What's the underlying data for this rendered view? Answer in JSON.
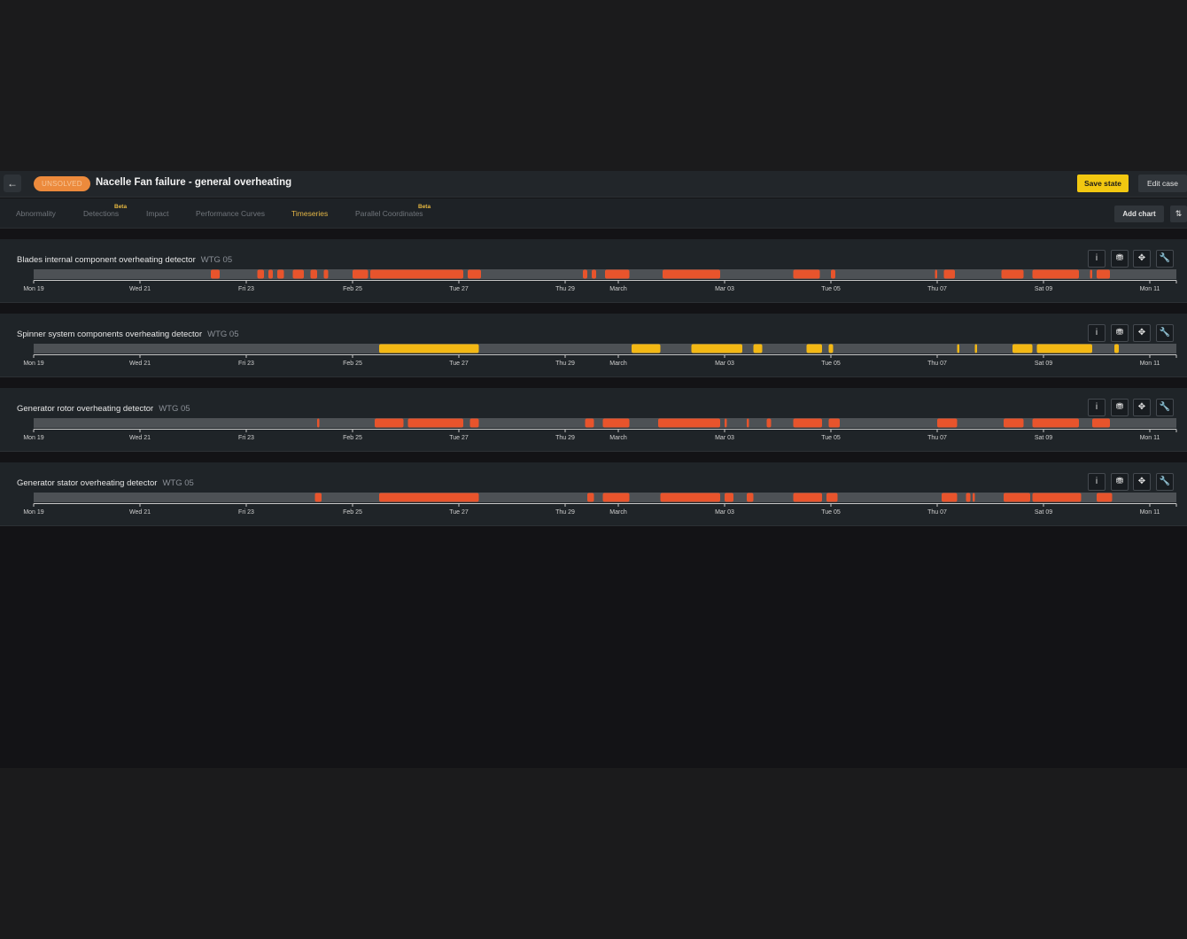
{
  "header": {
    "back_icon": "arrow-left-icon",
    "status": "UNSOLVED",
    "title": "Nacelle Fan failure - general overheating",
    "save_label": "Save state",
    "edit_label": "Edit case"
  },
  "tabs": [
    {
      "label": "Abnormality",
      "beta": ""
    },
    {
      "label": "Detections",
      "beta": "Beta"
    },
    {
      "label": "Impact",
      "beta": ""
    },
    {
      "label": "Performance Curves",
      "beta": ""
    },
    {
      "label": "Timeseries",
      "beta": ""
    },
    {
      "label": "Parallel Coordinates",
      "beta": "Beta"
    }
  ],
  "active_tab": "Timeseries",
  "toolbar": {
    "add_chart_label": "Add chart",
    "sort_icon": "sort-icon"
  },
  "controls": {
    "info": "i",
    "filter": "⛃",
    "move": "✥",
    "wrench": "🔧"
  },
  "colors": {
    "red_event": "#e8542c",
    "yellow_event": "#f3b814",
    "track": "#4d5155",
    "accent": "#f2c811"
  },
  "time_axis": {
    "start": "2024-02-19T00:00",
    "end": "2024-03-11T12:00",
    "ticks": [
      {
        "label": "Mon 19",
        "date": "2024-02-19"
      },
      {
        "label": "Wed 21",
        "date": "2024-02-21"
      },
      {
        "label": "Fri 23",
        "date": "2024-02-23"
      },
      {
        "label": "Feb 25",
        "date": "2024-02-25"
      },
      {
        "label": "Tue 27",
        "date": "2024-02-27"
      },
      {
        "label": "Thu 29",
        "date": "2024-02-29"
      },
      {
        "label": "March",
        "date": "2024-03-01"
      },
      {
        "label": "Mar 03",
        "date": "2024-03-03"
      },
      {
        "label": "Tue 05",
        "date": "2024-03-05"
      },
      {
        "label": "Thu 07",
        "date": "2024-03-07"
      },
      {
        "label": "Sat 09",
        "date": "2024-03-09"
      },
      {
        "label": "Mon 11",
        "date": "2024-03-11"
      }
    ]
  },
  "detectors": [
    {
      "name": "Blades internal component overheating detector",
      "asset": "WTG 05",
      "color": "#e8542c",
      "events": [
        [
          "2024-02-22T08:00",
          "2024-02-22T12:00"
        ],
        [
          "2024-02-23T05:00",
          "2024-02-23T08:00"
        ],
        [
          "2024-02-23T10:00",
          "2024-02-23T12:00"
        ],
        [
          "2024-02-23T14:00",
          "2024-02-23T17:00"
        ],
        [
          "2024-02-23T21:00",
          "2024-02-24T02:00"
        ],
        [
          "2024-02-24T05:00",
          "2024-02-24T08:00"
        ],
        [
          "2024-02-24T11:00",
          "2024-02-24T13:00"
        ],
        [
          "2024-02-25T00:00",
          "2024-02-25T07:00"
        ],
        [
          "2024-02-25T08:00",
          "2024-02-27T02:00"
        ],
        [
          "2024-02-27T04:00",
          "2024-02-27T10:00"
        ],
        [
          "2024-02-29T08:00",
          "2024-02-29T10:00"
        ],
        [
          "2024-02-29T12:00",
          "2024-02-29T14:00"
        ],
        [
          "2024-02-29T18:00",
          "2024-03-01T05:00"
        ],
        [
          "2024-03-01T20:00",
          "2024-03-02T22:00"
        ],
        [
          "2024-03-04T07:00",
          "2024-03-04T19:00"
        ],
        [
          "2024-03-05T00:00",
          "2024-03-05T02:00"
        ],
        [
          "2024-03-06T23:00",
          "2024-03-07T00:00"
        ],
        [
          "2024-03-07T03:00",
          "2024-03-07T08:00"
        ],
        [
          "2024-03-08T05:00",
          "2024-03-08T15:00"
        ],
        [
          "2024-03-08T19:00",
          "2024-03-09T16:00"
        ],
        [
          "2024-03-09T21:00",
          "2024-03-09T22:00"
        ],
        [
          "2024-03-10T00:00",
          "2024-03-10T06:00"
        ]
      ]
    },
    {
      "name": "Spinner system components overheating detector",
      "asset": "WTG 05",
      "color": "#f3b814",
      "events": [
        [
          "2024-02-25T12:00",
          "2024-02-27T09:00"
        ],
        [
          "2024-03-01T06:00",
          "2024-03-01T19:00"
        ],
        [
          "2024-03-02T09:00",
          "2024-03-03T08:00"
        ],
        [
          "2024-03-03T13:00",
          "2024-03-03T17:00"
        ],
        [
          "2024-03-04T13:00",
          "2024-03-04T20:00"
        ],
        [
          "2024-03-04T23:00",
          "2024-03-05T01:00"
        ],
        [
          "2024-03-07T09:00",
          "2024-03-07T10:00"
        ],
        [
          "2024-03-07T17:00",
          "2024-03-07T18:00"
        ],
        [
          "2024-03-08T10:00",
          "2024-03-08T19:00"
        ],
        [
          "2024-03-08T21:00",
          "2024-03-09T22:00"
        ],
        [
          "2024-03-10T08:00",
          "2024-03-10T10:00"
        ]
      ]
    },
    {
      "name": "Generator rotor overheating detector",
      "asset": "WTG 05",
      "color": "#e8542c",
      "events": [
        [
          "2024-02-24T08:00",
          "2024-02-24T09:00"
        ],
        [
          "2024-02-25T10:00",
          "2024-02-25T23:00"
        ],
        [
          "2024-02-26T01:00",
          "2024-02-27T02:00"
        ],
        [
          "2024-02-27T05:00",
          "2024-02-27T09:00"
        ],
        [
          "2024-02-29T09:00",
          "2024-02-29T13:00"
        ],
        [
          "2024-02-29T17:00",
          "2024-03-01T05:00"
        ],
        [
          "2024-03-01T18:00",
          "2024-03-02T22:00"
        ],
        [
          "2024-03-03T00:00",
          "2024-03-03T01:00"
        ],
        [
          "2024-03-03T10:00",
          "2024-03-03T11:00"
        ],
        [
          "2024-03-03T19:00",
          "2024-03-03T21:00"
        ],
        [
          "2024-03-04T07:00",
          "2024-03-04T20:00"
        ],
        [
          "2024-03-04T23:00",
          "2024-03-05T04:00"
        ],
        [
          "2024-03-07T00:00",
          "2024-03-07T09:00"
        ],
        [
          "2024-03-08T06:00",
          "2024-03-08T15:00"
        ],
        [
          "2024-03-08T19:00",
          "2024-03-09T16:00"
        ],
        [
          "2024-03-09T22:00",
          "2024-03-10T06:00"
        ]
      ]
    },
    {
      "name": "Generator stator overheating detector",
      "asset": "WTG 05",
      "color": "#e8542c",
      "events": [
        [
          "2024-02-24T07:00",
          "2024-02-24T10:00"
        ],
        [
          "2024-02-25T12:00",
          "2024-02-27T09:00"
        ],
        [
          "2024-02-29T10:00",
          "2024-02-29T13:00"
        ],
        [
          "2024-02-29T17:00",
          "2024-03-01T05:00"
        ],
        [
          "2024-03-01T19:00",
          "2024-03-02T22:00"
        ],
        [
          "2024-03-03T00:00",
          "2024-03-03T04:00"
        ],
        [
          "2024-03-03T10:00",
          "2024-03-03T13:00"
        ],
        [
          "2024-03-04T07:00",
          "2024-03-04T20:00"
        ],
        [
          "2024-03-04T22:00",
          "2024-03-05T03:00"
        ],
        [
          "2024-03-07T02:00",
          "2024-03-07T09:00"
        ],
        [
          "2024-03-07T13:00",
          "2024-03-07T15:00"
        ],
        [
          "2024-03-07T16:00",
          "2024-03-07T17:00"
        ],
        [
          "2024-03-08T06:00",
          "2024-03-08T18:00"
        ],
        [
          "2024-03-08T19:00",
          "2024-03-09T17:00"
        ],
        [
          "2024-03-10T00:00",
          "2024-03-10T07:00"
        ]
      ]
    }
  ]
}
